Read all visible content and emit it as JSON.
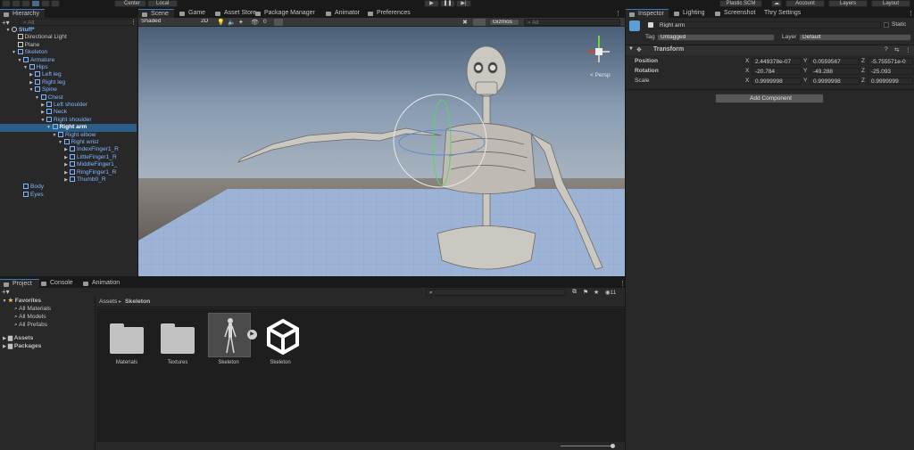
{
  "toolbar": {
    "pivot_center": "Center",
    "pivot_local": "Local",
    "account": "Account",
    "layers": "Layers",
    "layout": "Layout",
    "plastic": "Plastic SCM"
  },
  "hierarchy": {
    "tab": "Hierarchy",
    "search_placeholder": "All",
    "items": [
      {
        "label": "Stuff*",
        "depth": 0,
        "arrow": "▼",
        "kind": "scene"
      },
      {
        "label": "Directional Light",
        "depth": 1,
        "arrow": "",
        "kind": "cube"
      },
      {
        "label": "Plane",
        "depth": 1,
        "arrow": "",
        "kind": "cube"
      },
      {
        "label": "Skeleton",
        "depth": 1,
        "arrow": "▼",
        "kind": "prefab"
      },
      {
        "label": "Armature",
        "depth": 2,
        "arrow": "▼",
        "kind": "cube"
      },
      {
        "label": "Hips",
        "depth": 3,
        "arrow": "▼",
        "kind": "cube"
      },
      {
        "label": "Left leg",
        "depth": 4,
        "arrow": "▶",
        "kind": "cube"
      },
      {
        "label": "Right leg",
        "depth": 4,
        "arrow": "▶",
        "kind": "cube"
      },
      {
        "label": "Spine",
        "depth": 4,
        "arrow": "▼",
        "kind": "cube"
      },
      {
        "label": "Chest",
        "depth": 5,
        "arrow": "▼",
        "kind": "cube"
      },
      {
        "label": "Left shoulder",
        "depth": 6,
        "arrow": "▶",
        "kind": "cube"
      },
      {
        "label": "Neck",
        "depth": 6,
        "arrow": "▶",
        "kind": "cube"
      },
      {
        "label": "Right shoulder",
        "depth": 6,
        "arrow": "▼",
        "kind": "cube"
      },
      {
        "label": "Right arm",
        "depth": 7,
        "arrow": "▼",
        "kind": "cube",
        "selected": true
      },
      {
        "label": "Right elbow",
        "depth": 8,
        "arrow": "▼",
        "kind": "cube"
      },
      {
        "label": "Right wrist",
        "depth": 9,
        "arrow": "▼",
        "kind": "cube"
      },
      {
        "label": "IndexFinger1_R",
        "depth": 10,
        "arrow": "▶",
        "kind": "cube"
      },
      {
        "label": "LittleFinger1_R",
        "depth": 10,
        "arrow": "▶",
        "kind": "cube"
      },
      {
        "label": "MiddleFinger1_",
        "depth": 10,
        "arrow": "▶",
        "kind": "cube"
      },
      {
        "label": "RingFinger1_R",
        "depth": 10,
        "arrow": "▶",
        "kind": "cube"
      },
      {
        "label": "Thumb0_R",
        "depth": 10,
        "arrow": "▶",
        "kind": "cube"
      },
      {
        "label": "Body",
        "depth": 2,
        "arrow": "",
        "kind": "cube"
      },
      {
        "label": "Eyes",
        "depth": 2,
        "arrow": "",
        "kind": "cube"
      }
    ]
  },
  "scene": {
    "tabs": [
      "Scene",
      "Game",
      "Asset Store",
      "Package Manager",
      "Animator",
      "Preferences"
    ],
    "shading": "Shaded",
    "mode_2d": "2D",
    "gizmos": "Gizmos",
    "search_placeholder": "All",
    "persp": "< Persp",
    "layer_count": "0"
  },
  "inspector": {
    "tabs": [
      "Inspector",
      "Lighting",
      "Screenshot",
      "Thry Settings"
    ],
    "object_name": "Right arm",
    "static": "Static",
    "tag_label": "Tag",
    "tag_value": "Untagged",
    "layer_label": "Layer",
    "layer_value": "Default",
    "component": "Transform",
    "position_label": "Position",
    "rotation_label": "Rotation",
    "scale_label": "Scale",
    "position": {
      "x": "2.449378e-07",
      "y": "0.0559567",
      "z": "-5.755571e-0"
    },
    "rotation": {
      "x": "-20.784",
      "y": "-49.288",
      "z": "-25.093"
    },
    "scale": {
      "x": "0.9999998",
      "y": "0.9999998",
      "z": "0.9999999"
    },
    "add_component": "Add Component"
  },
  "project": {
    "tabs": [
      "Project",
      "Console",
      "Animation"
    ],
    "favorites": "Favorites",
    "fav_items": [
      "All Materials",
      "All Models",
      "All Prefabs"
    ],
    "assets": "Assets",
    "packages": "Packages",
    "breadcrumb_root": "Assets",
    "breadcrumb_sep": "▸",
    "breadcrumb_leaf": "Skeleton",
    "hidden_count": "11",
    "items": [
      {
        "label": "Materials",
        "kind": "folder"
      },
      {
        "label": "Textures",
        "kind": "folder"
      },
      {
        "label": "Skeleton",
        "kind": "model"
      },
      {
        "label": "Skeleton",
        "kind": "unity"
      }
    ]
  },
  "colors": {
    "selection": "#2c5d87",
    "accent": "#3a79bb",
    "sky": "#7d8fa3",
    "ground": "#6f6a64"
  }
}
